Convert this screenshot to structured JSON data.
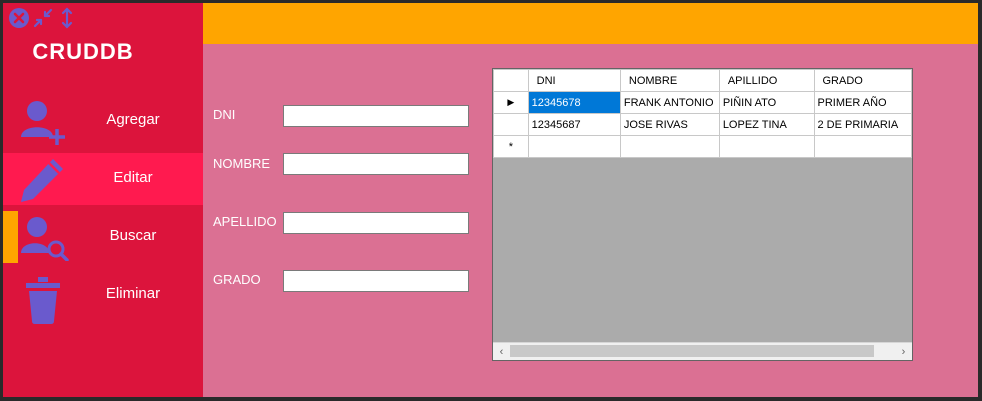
{
  "app": {
    "title": "CRUDDB"
  },
  "window_buttons": [
    "close-icon",
    "minimize-icon",
    "resize-icon"
  ],
  "nav": [
    {
      "label": "Agregar",
      "icon": "add-user-icon",
      "active": false
    },
    {
      "label": "Editar",
      "icon": "pencil-icon",
      "active": true
    },
    {
      "label": "Buscar",
      "icon": "search-user-icon",
      "active": false
    },
    {
      "label": "Eliminar",
      "icon": "trash-icon",
      "active": false
    }
  ],
  "form": {
    "dni_label": "DNI",
    "nombre_label": "NOMBRE",
    "apellido_label": "APELLIDO",
    "grado_label": "GRADO",
    "dni_value": "",
    "nombre_value": "",
    "apellido_value": "",
    "grado_value": ""
  },
  "grid": {
    "columns": [
      "DNI",
      "NOMBRE",
      "APILLIDO",
      "GRADO"
    ],
    "rows": [
      [
        "12345678",
        "FRANK ANTONIO",
        "PIÑIN ATO",
        "PRIMER AÑO"
      ],
      [
        "12345687",
        "JOSE RIVAS",
        "LOPEZ TINA",
        "2 DE PRIMARIA"
      ]
    ],
    "current_row_marker": "▶",
    "new_row_marker": "*"
  },
  "colors": {
    "sidebar": "#dc143c",
    "active_item": "#ff1a4f",
    "topbar": "#ffa500",
    "main": "#db7093",
    "icon": "#6a5acd",
    "selection": "#0078d7"
  }
}
